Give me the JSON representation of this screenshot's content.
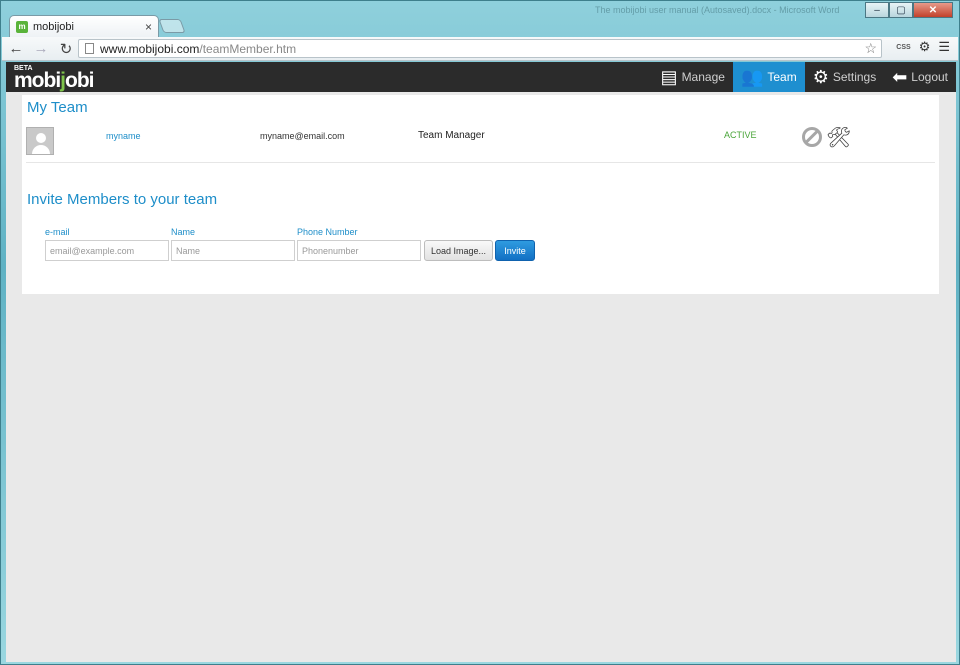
{
  "browser": {
    "tab_title": "mobijobi",
    "tab_close": "×",
    "faint_title": "The mobijobi user manual (Autosaved).docx - Microsoft Word",
    "url_host": "www.mobijobi.com",
    "url_path": "/teamMember.htm",
    "window_controls": {
      "minimize": "–",
      "maximize": "▢",
      "close": "✕"
    }
  },
  "app": {
    "logo_beta": "BETA",
    "logo_main": "mobi",
    "logo_highlight": "j",
    "logo_tail": "obi",
    "nav": [
      {
        "label": "Manage",
        "icon": "list-icon",
        "active": false
      },
      {
        "label": "Team",
        "icon": "team-icon",
        "active": true
      },
      {
        "label": "Settings",
        "icon": "gear-icon",
        "active": false
      },
      {
        "label": "Logout",
        "icon": "arrow-left-icon",
        "active": false
      }
    ],
    "accent_color": "#1e8fd0"
  },
  "my_team": {
    "heading": "My Team",
    "members": [
      {
        "name": "myname",
        "email": "myname@email.com",
        "role": "Team Manager",
        "status": "ACTIVE"
      }
    ]
  },
  "invite": {
    "heading": "Invite Members to your team",
    "email_label": "e-mail",
    "email_placeholder": "email@example.com",
    "name_label": "Name",
    "name_placeholder": "Name",
    "phone_label": "Phone Number",
    "phone_placeholder": "Phonenumber",
    "load_image_label": "Load Image...",
    "invite_label": "Invite"
  }
}
